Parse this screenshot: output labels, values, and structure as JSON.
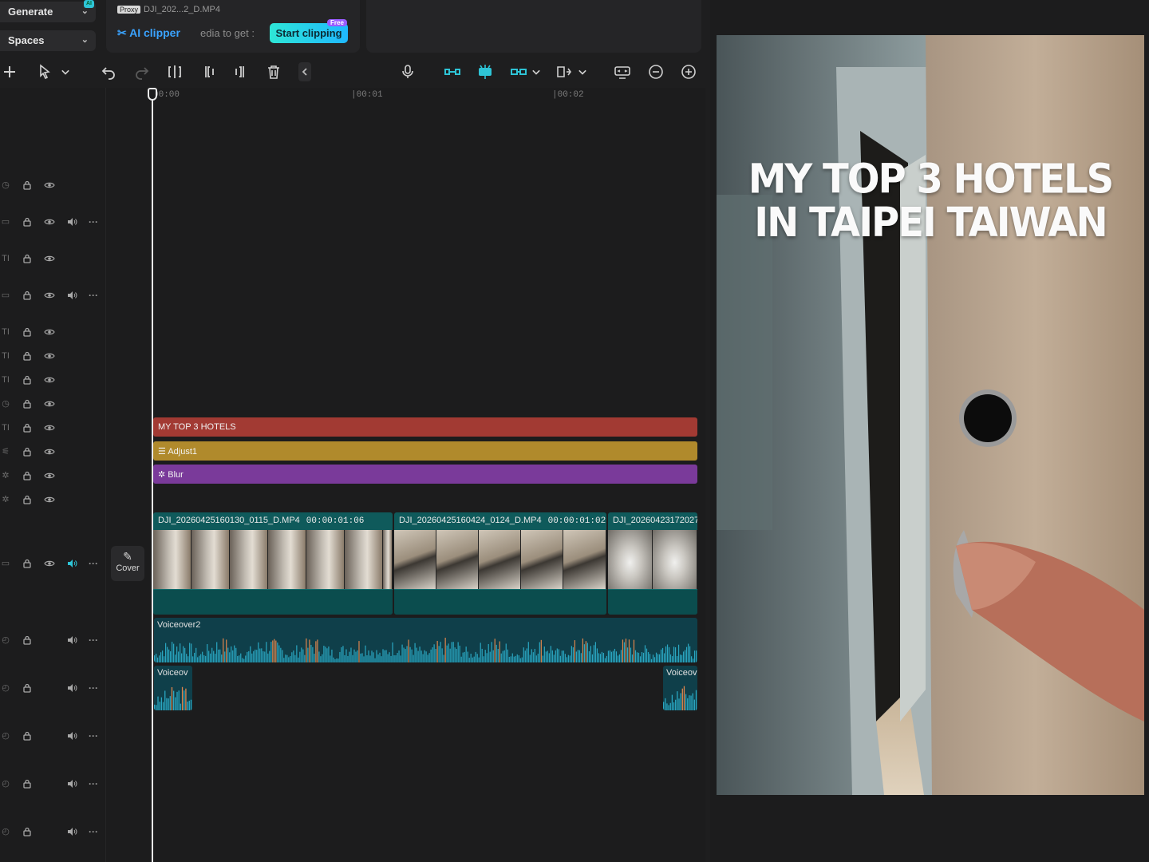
{
  "sidebar": {
    "generate_label": "Generate",
    "spaces_label": "Spaces",
    "ai_badge": "AI"
  },
  "media": {
    "proxy_tag": "Proxy",
    "file_name": "DJI_202...2_D.MP4",
    "ai_clipper_label": "AI clipper",
    "ai_clipper_hint": "edia to get :",
    "start_clipping_label": "Start clipping",
    "free_tag": "Free"
  },
  "ruler": {
    "ticks": [
      "00:00",
      "|00:01",
      "|00:02"
    ]
  },
  "timeline": {
    "cover_label": "Cover",
    "text_clip_label": "MY TOP 3 HOTELS",
    "adjust_clip_label": "Adjust1",
    "blur_clip_label": "Blur",
    "video_clips": [
      {
        "name": "DJI_20260425160130_0115_D.MP4",
        "duration": "00:00:01:06"
      },
      {
        "name": "DJI_20260425160424_0124_D.MP4",
        "duration": "00:00:01:02"
      },
      {
        "name": "DJI_20260423172027",
        "duration": ""
      }
    ],
    "voiceover_main": "Voiceover2",
    "voiceover_left": "Voiceov",
    "voiceover_right": "Voiceov"
  },
  "preview": {
    "title_line1": "MY TOP 3 HOTELS",
    "title_line2": "IN TAIPEI TAIWAN"
  },
  "colors": {
    "accent": "#2ec4d6",
    "text_track": "#a23a33",
    "adjust_track": "#b08a2c",
    "blur_track": "#7a3a9a",
    "video_track": "#0f5a5b",
    "audio_track": "#0f3f4a"
  }
}
